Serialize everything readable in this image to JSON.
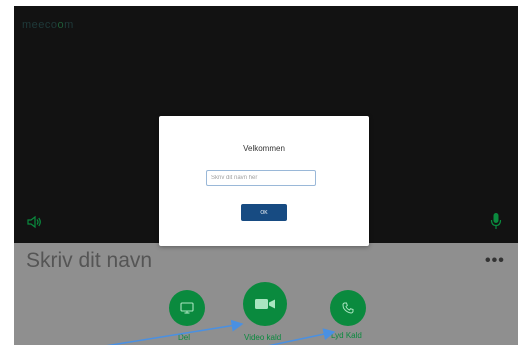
{
  "app": {
    "logo_prefix": "meeco",
    "logo_accent": "o",
    "logo_suffix": "m"
  },
  "main": {
    "name_title": "Skriv dit navn",
    "more_label": "•••"
  },
  "actions": [
    {
      "label": "Del",
      "icon": "monitor-icon"
    },
    {
      "label": "Video kald",
      "icon": "video-camera-icon"
    },
    {
      "label": "Lyd Kald",
      "icon": "phone-icon"
    }
  ],
  "modal": {
    "title": "Velkommen",
    "input_value": "",
    "input_placeholder": "Skriv dit navn her",
    "ok_label": "OK"
  },
  "colors": {
    "video_bg": "#121212",
    "panel_bg": "#8f8f8f",
    "action_green": "#0a8a3e",
    "ok_blue": "#174b82",
    "arrow_blue": "#4a90e2"
  }
}
